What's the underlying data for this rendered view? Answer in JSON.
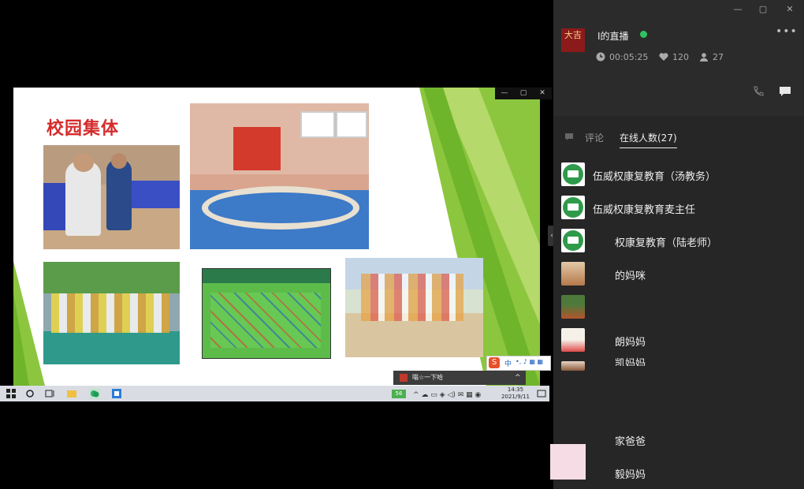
{
  "slide": {
    "title": "校园集体"
  },
  "notification": {
    "text": "嗡☆一下哈"
  },
  "clock": {
    "time": "14:35",
    "date": "2021/9/11"
  },
  "taskbar_badge": "56",
  "ime": {
    "label": "中"
  },
  "panel": {
    "host_avatar_text": "大吉",
    "live_title": "I的直播",
    "status_color": "#2fc35e",
    "duration": "00:05:25",
    "likes": "120",
    "viewers": "27"
  },
  "tabs": {
    "comment": "评论",
    "online": "在线人数(27)"
  },
  "users": [
    {
      "name": "伍威权康复教育（汤教务）",
      "avatar": "logo"
    },
    {
      "name": "伍威权康复教育麦主任",
      "avatar": "logo"
    },
    {
      "name": "权康复教育（陆老师）",
      "avatar": "logo"
    },
    {
      "name": "的妈咪",
      "avatar": "dog"
    },
    {
      "name": "",
      "avatar": "outdoor"
    },
    {
      "name": "朗妈妈",
      "avatar": "cartoon"
    },
    {
      "name": "凯妈妈",
      "avatar": "child"
    },
    {
      "name": "家爸爸",
      "avatar": "none"
    },
    {
      "name": "毅妈妈",
      "avatar": "none"
    }
  ]
}
